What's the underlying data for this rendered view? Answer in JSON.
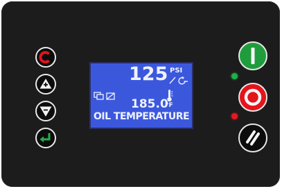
{
  "display": {
    "pressure_value": "125",
    "pressure_unit": "PSI",
    "temperature_value": "185.0",
    "temperature_unit": "°F",
    "parameter_label": "OIL TEMPERATURE"
  },
  "colors": {
    "panel": "#1c1c1d",
    "lcd_background": "#3b58dd",
    "lcd_text": "#eef2ff",
    "start_button": "#1f9d3c",
    "stop_button": "#e3141b",
    "green_led": "#1fb04a",
    "red_led": "#e21a1f"
  },
  "icons": {
    "reset_key": "c-reset-icon",
    "up_key": "triangle-up-icon",
    "down_key": "triangle-down-icon",
    "enter_key": "enter-arrow-icon",
    "start_button": "start-i-icon",
    "stop_button": "stop-o-icon",
    "unload_button": "double-slash-icon"
  }
}
